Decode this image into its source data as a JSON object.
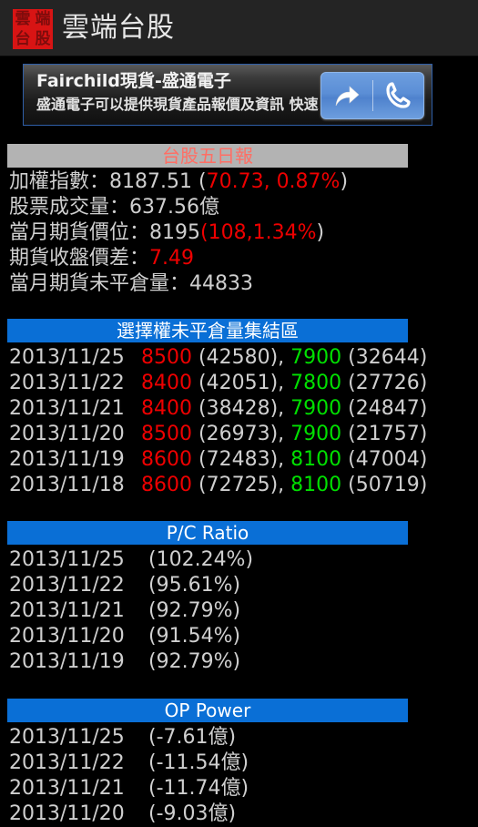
{
  "app": {
    "logo_chars": [
      "雲",
      "端",
      "台",
      "股"
    ],
    "title": "雲端台股",
    "logo_bg": "#d81414"
  },
  "ad": {
    "title": "Fairchild現貨-盛通電子",
    "subtitle": "盛通電子可以提供現貨產品報價及資訊 快速",
    "share_icon": "share-arrow-icon",
    "call_icon": "phone-icon",
    "border_color": "#2f5fa8",
    "button_color": "#5b8ed6"
  },
  "summary": {
    "header": "台股五日報",
    "header_bg": "#b3b3b3",
    "header_color": "#ff6e64",
    "rows": [
      {
        "label": "加權指數：",
        "value": "8187.51 ",
        "paren_open": "(",
        "change": "70.73",
        "sep": ", ",
        "change_pct": "0.87%",
        "paren_close": ")"
      },
      {
        "label": "股票成交量：",
        "value": "637.56億"
      },
      {
        "label": "當月期貨價位：",
        "value": "8195",
        "paren_open": "(",
        "change": "108",
        "sep": ",",
        "change_pct": "1.34%",
        "paren_close": ")"
      },
      {
        "label": "期貨收盤價差：",
        "highlight": "7.49"
      },
      {
        "label": "當月期貨未平倉量：",
        "value": "44833"
      }
    ]
  },
  "open_interest": {
    "header": "選擇權未平倉量集結區",
    "header_bg": "#0a6fd6",
    "rows": [
      {
        "date": "2013/11/25",
        "date_color": "#cfcfcf",
        "call_strike": "8500",
        "call_oi": "(42580)",
        "sep": ", ",
        "put_strike": "7900",
        "put_oi": "(32644)"
      },
      {
        "date": "2013/11/22",
        "date_color": "#cfcfcf",
        "call_strike": "8400",
        "call_oi": "(42051)",
        "sep": ", ",
        "put_strike": "7800",
        "put_oi": "(27726)"
      },
      {
        "date": "2013/11/21",
        "date_color": "#cfcfcf",
        "call_strike": "8400",
        "call_oi": "(38428)",
        "sep": ", ",
        "put_strike": "7900",
        "put_oi": "(24847)"
      },
      {
        "date": "2013/11/20",
        "date_color": "#ffff00",
        "call_strike": "8500",
        "call_oi": "(26973)",
        "sep": ", ",
        "put_strike": "7900",
        "put_oi": "(21757)"
      },
      {
        "date": "2013/11/19",
        "date_color": "#cfcfcf",
        "call_strike": "8600",
        "call_oi": "(72483)",
        "sep": ", ",
        "put_strike": "8100",
        "put_oi": "(47004)"
      },
      {
        "date": "2013/11/18",
        "date_color": "#cfcfcf",
        "call_strike": "8600",
        "call_oi": "(72725)",
        "sep": ", ",
        "put_strike": "8100",
        "put_oi": "(50719)"
      }
    ]
  },
  "pc_ratio": {
    "header": "P/C Ratio",
    "header_bg": "#0a6fd6",
    "rows": [
      {
        "date": "2013/11/25",
        "value": "(102.24%)",
        "color": "#00e000"
      },
      {
        "date": "2013/11/22",
        "value": "(95.61%)",
        "color": "#ee0000"
      },
      {
        "date": "2013/11/21",
        "value": "(92.79%)",
        "color": "#ee0000"
      },
      {
        "date": "2013/11/20",
        "value": "(91.54%)",
        "color": "#ee0000"
      },
      {
        "date": "2013/11/19",
        "value": "(92.79%)",
        "color": "#ee0000"
      }
    ]
  },
  "op_power": {
    "header": "OP Power",
    "header_bg": "#0a6fd6",
    "rows": [
      {
        "date": "2013/11/25",
        "value": "(-7.61億)",
        "color": "#00e000"
      },
      {
        "date": "2013/11/22",
        "value": "(-11.54億)",
        "color": "#00e000"
      },
      {
        "date": "2013/11/21",
        "value": "(-11.74億)",
        "color": "#00e000"
      },
      {
        "date": "2013/11/20",
        "value": "(-9.03億)",
        "color": "#00e000"
      }
    ]
  }
}
